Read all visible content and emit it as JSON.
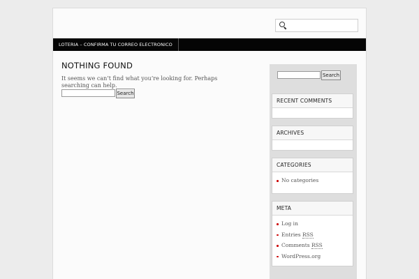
{
  "header": {
    "search_placeholder": ""
  },
  "nav": {
    "items": [
      {
        "label": "LOTERIA – CONFIRMA TU CORREO ELECTRONICO"
      }
    ]
  },
  "main": {
    "title": "NOTHING FOUND",
    "message": "It seems we can’t find what you’re looking for. Perhaps searching can help.",
    "search_value": "",
    "search_button": "Search"
  },
  "sidebar": {
    "search_value": "",
    "search_button": "Search",
    "recent_comments": {
      "title": "RECENT COMMENTS"
    },
    "archives": {
      "title": "ARCHIVES"
    },
    "categories": {
      "title": "CATEGORIES",
      "items": [
        "No categories"
      ]
    },
    "meta": {
      "title": "META",
      "items": [
        {
          "label": "Log in"
        },
        {
          "prefix": "Entries ",
          "abbr": "RSS"
        },
        {
          "prefix": "Comments ",
          "abbr": "RSS"
        },
        {
          "label": "WordPress.org"
        }
      ]
    }
  },
  "colors": {
    "nav_bg": "#050505",
    "bullet": "#cc0000",
    "page_bg": "#ececec"
  }
}
